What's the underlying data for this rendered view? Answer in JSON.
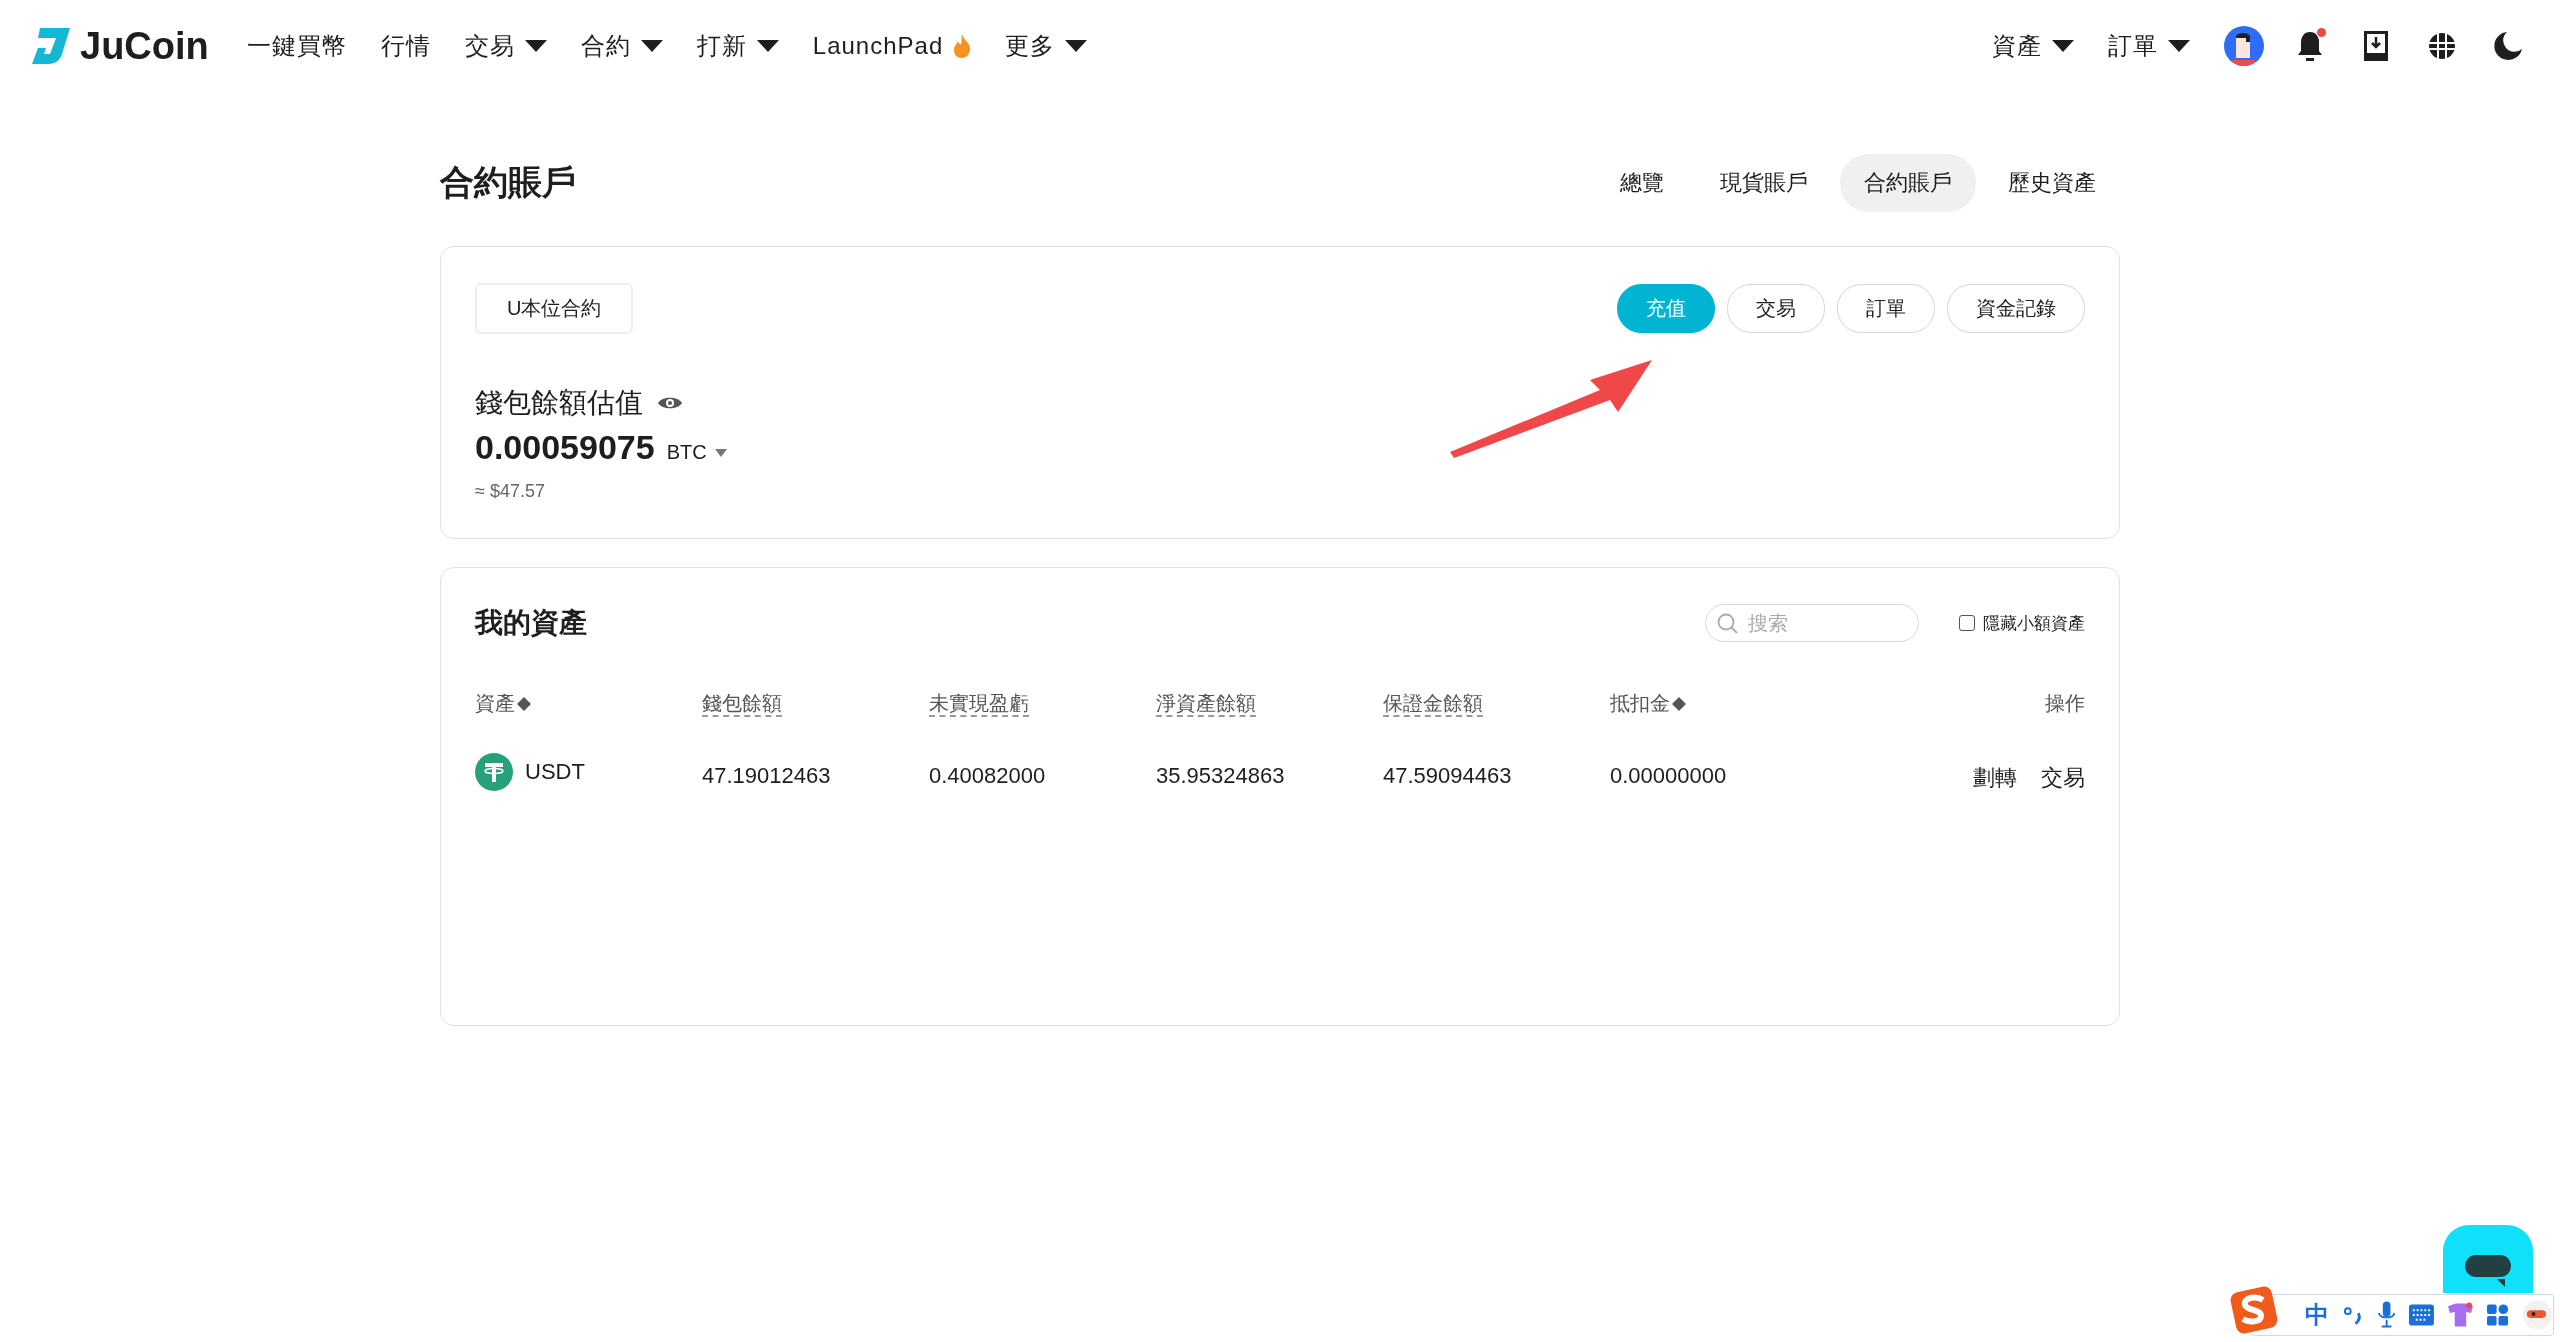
{
  "nav": {
    "logo": "JuCoin",
    "items": [
      {
        "label": "一鍵買幣",
        "kind": "link"
      },
      {
        "label": "行情",
        "kind": "link"
      },
      {
        "label": "交易",
        "kind": "dropdown"
      },
      {
        "label": "合約",
        "kind": "dropdown"
      },
      {
        "label": "打新",
        "kind": "dropdown"
      },
      {
        "label": "LaunchPad",
        "kind": "hot"
      },
      {
        "label": "更多",
        "kind": "dropdown"
      }
    ],
    "right_items": [
      {
        "label": "資產",
        "kind": "dropdown"
      },
      {
        "label": "訂單",
        "kind": "dropdown"
      }
    ],
    "notification_unread": true
  },
  "page": {
    "title": "合約賬戶",
    "tabs": [
      {
        "label": "總覽",
        "selected": false
      },
      {
        "label": "現貨賬戶",
        "selected": false
      },
      {
        "label": "合約賬戶",
        "selected": true
      },
      {
        "label": "歷史資產",
        "selected": false
      }
    ]
  },
  "account_card": {
    "tag": "U本位合約",
    "actions": [
      {
        "label": "充值",
        "primary": true
      },
      {
        "label": "交易",
        "primary": false
      },
      {
        "label": "訂單",
        "primary": false
      },
      {
        "label": "資金記錄",
        "primary": false
      }
    ],
    "balance_label": "錢包餘額估值",
    "amount": "0.00059075",
    "unit": "BTC",
    "approx": "≈ $47.57"
  },
  "assets": {
    "title": "我的資產",
    "search": {
      "placeholder": "搜索"
    },
    "hide_small": {
      "label": "隱藏小額資產",
      "checked": false
    },
    "columns": [
      {
        "label": "資產",
        "sortable": true,
        "hint": false
      },
      {
        "label": "錢包餘額",
        "sortable": false,
        "hint": true
      },
      {
        "label": "未實現盈虧",
        "sortable": false,
        "hint": true
      },
      {
        "label": "淨資產餘額",
        "sortable": false,
        "hint": true
      },
      {
        "label": "保證金餘額",
        "sortable": false,
        "hint": true
      },
      {
        "label": "抵扣金",
        "sortable": true,
        "hint": false
      },
      {
        "label": "操作",
        "sortable": false,
        "hint": false
      }
    ],
    "rows": [
      {
        "cells": [
          "USDT",
          "47.19012463",
          "0.40082000",
          "35.95324863",
          "47.59094463",
          "0.00000000"
        ],
        "actions": [
          "劃轉",
          "交易"
        ]
      }
    ]
  },
  "ime_bar": {
    "mode": "中"
  }
}
